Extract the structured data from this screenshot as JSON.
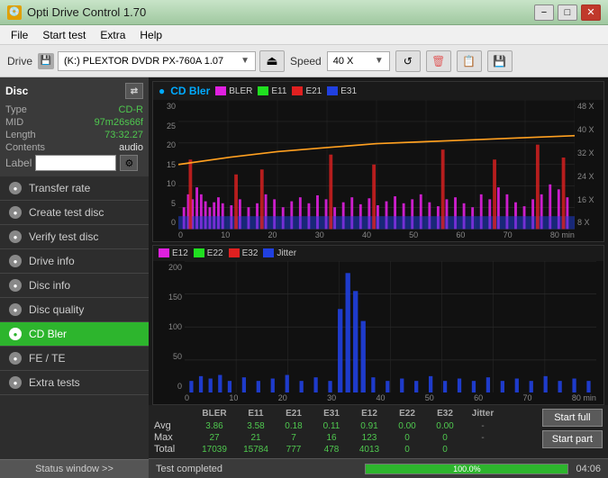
{
  "titlebar": {
    "icon": "💿",
    "title": "Opti Drive Control 1.70",
    "minimize": "−",
    "maximize": "□",
    "close": "✕"
  },
  "menu": {
    "items": [
      "File",
      "Start test",
      "Extra",
      "Help"
    ]
  },
  "toolbar": {
    "drive_label": "Drive",
    "drive_icon": "💾",
    "drive_value": "(K:)  PLEXTOR DVDR  PX-760A 1.07",
    "speed_label": "Speed",
    "speed_value": "40 X"
  },
  "disc": {
    "header": "Disc",
    "type_label": "Type",
    "type_value": "CD-R",
    "mid_label": "MID",
    "mid_value": "97m26s66f",
    "length_label": "Length",
    "length_value": "73:32.27",
    "contents_label": "Contents",
    "contents_value": "audio",
    "label_label": "Label",
    "label_value": ""
  },
  "sidebar": {
    "items": [
      {
        "id": "transfer-rate",
        "label": "Transfer rate",
        "active": false
      },
      {
        "id": "create-test-disc",
        "label": "Create test disc",
        "active": false
      },
      {
        "id": "verify-test-disc",
        "label": "Verify test disc",
        "active": false
      },
      {
        "id": "drive-info",
        "label": "Drive info",
        "active": false
      },
      {
        "id": "disc-info",
        "label": "Disc info",
        "active": false
      },
      {
        "id": "disc-quality",
        "label": "Disc quality",
        "active": false
      },
      {
        "id": "cd-bler",
        "label": "CD Bler",
        "active": true
      },
      {
        "id": "fe-te",
        "label": "FE / TE",
        "active": false
      },
      {
        "id": "extra-tests",
        "label": "Extra tests",
        "active": false
      }
    ],
    "status_btn": "Status window >>"
  },
  "chart1": {
    "title": "CD Bler",
    "legend": [
      {
        "label": "BLER",
        "color": "#e020e0"
      },
      {
        "label": "E11",
        "color": "#20e020"
      },
      {
        "label": "E21",
        "color": "#e02020"
      },
      {
        "label": "E31",
        "color": "#2040e0"
      }
    ],
    "y_left": [
      "30",
      "25",
      "20",
      "15",
      "10",
      "5",
      "0"
    ],
    "y_right": [
      "48 X",
      "40 X",
      "32 X",
      "24 X",
      "16 X",
      "8 X"
    ],
    "x_axis": [
      "0",
      "10",
      "20",
      "30",
      "40",
      "50",
      "60",
      "70",
      "80 min"
    ]
  },
  "chart2": {
    "legend": [
      {
        "label": "E12",
        "color": "#e020e0"
      },
      {
        "label": "E22",
        "color": "#20e020"
      },
      {
        "label": "E32",
        "color": "#e02020"
      },
      {
        "label": "Jitter",
        "color": "#2040e0"
      }
    ],
    "y_left": [
      "200",
      "150",
      "100",
      "50",
      "0"
    ],
    "x_axis": [
      "0",
      "10",
      "20",
      "30",
      "40",
      "50",
      "60",
      "70",
      "80 min"
    ]
  },
  "stats": {
    "columns": [
      "BLER",
      "E11",
      "E21",
      "E31",
      "E12",
      "E22",
      "E32",
      "Jitter"
    ],
    "rows": [
      {
        "label": "Avg",
        "values": [
          "3.86",
          "3.58",
          "0.18",
          "0.11",
          "0.91",
          "0.00",
          "0.00",
          "-"
        ]
      },
      {
        "label": "Max",
        "values": [
          "27",
          "21",
          "7",
          "16",
          "123",
          "0",
          "0",
          "-"
        ]
      },
      {
        "label": "Total",
        "values": [
          "17039",
          "15784",
          "777",
          "478",
          "4013",
          "0",
          "0",
          ""
        ]
      }
    ],
    "btn_full": "Start full",
    "btn_part": "Start part"
  },
  "statusbar": {
    "text": "Test completed",
    "progress": 100.0,
    "progress_text": "100.0%",
    "time": "04:06"
  }
}
